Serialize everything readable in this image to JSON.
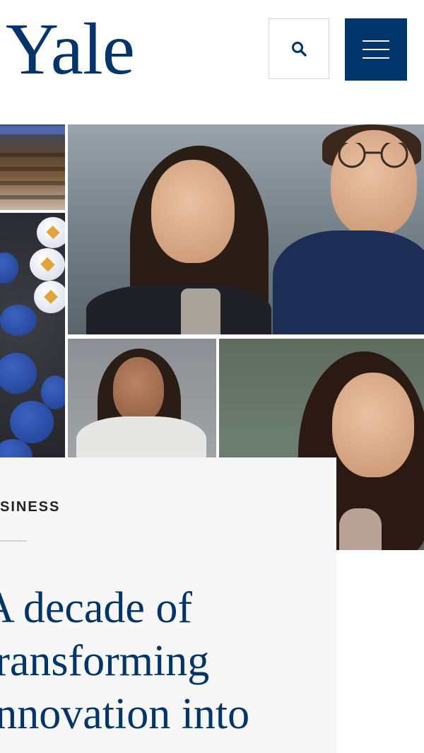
{
  "header": {
    "logo_text": "Yale",
    "search_icon": "search-icon",
    "menu_icon": "hamburger-menu-icon",
    "brand_color": "#00356b"
  },
  "collage": {
    "images": [
      "auditorium-photo",
      "buttons-pins-photo",
      "two-people-photo",
      "woman-portrait-photo",
      "woman-portrait-photo"
    ]
  },
  "article": {
    "category": "SINESS",
    "headline_lines": [
      "A decade of",
      "transforming",
      "innovation into"
    ]
  }
}
